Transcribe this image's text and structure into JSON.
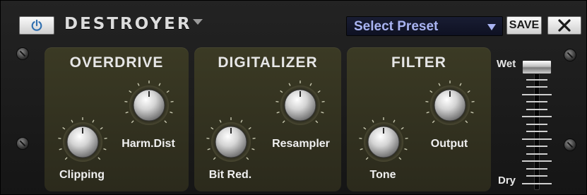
{
  "header": {
    "title": "DESTROYER",
    "preset_label": "Select Preset",
    "save_label": "SAVE",
    "close_label": "✕",
    "power_icon": "power-icon"
  },
  "panels": [
    {
      "title": "OVERDRIVE",
      "knobs": [
        {
          "label": "Clipping"
        },
        {
          "label": "Harm.Dist"
        }
      ]
    },
    {
      "title": "DIGITALIZER",
      "knobs": [
        {
          "label": "Bit Red."
        },
        {
          "label": "Resampler"
        }
      ]
    },
    {
      "title": "FILTER",
      "knobs": [
        {
          "label": "Tone"
        },
        {
          "label": "Output"
        }
      ]
    }
  ],
  "fader": {
    "wet_label": "Wet",
    "dry_label": "Dry",
    "value": 1.0
  },
  "colors": {
    "panel": "#353421",
    "preset_text": "#a9b4f2",
    "power_accent": "#2f6fb0"
  }
}
